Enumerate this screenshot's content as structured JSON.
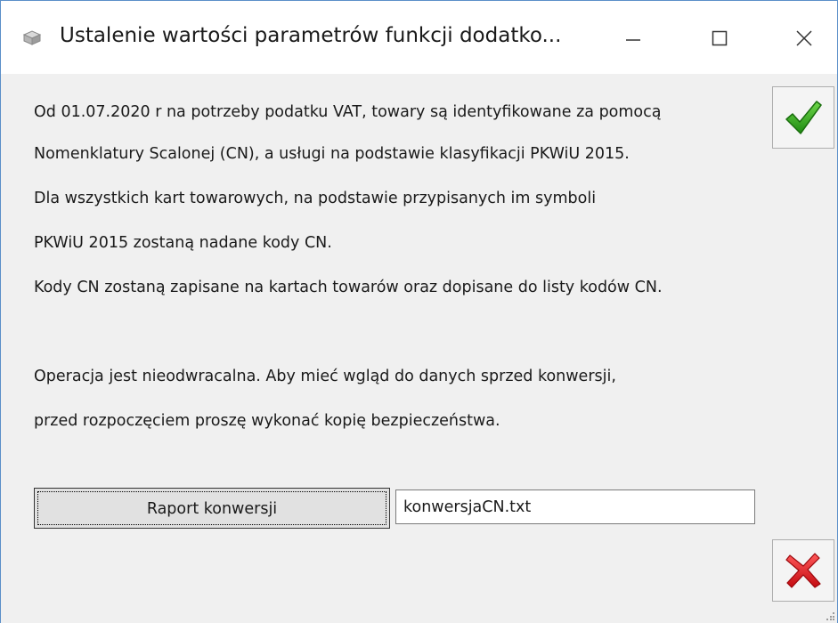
{
  "window": {
    "title": "Ustalenie wartości parametrów funkcji dodatko...",
    "controls": {
      "minimize_icon": "minimize-icon",
      "maximize_icon": "maximize-icon",
      "close_icon": "close-icon"
    }
  },
  "message": {
    "lines": [
      "Od 01.07.2020 r na potrzeby podatku VAT, towary są identyfikowane za pomocą",
      "Nomenklatury Scalonej (CN), a usługi na podstawie klasyfikacji PKWiU 2015.",
      "Dla wszystkich kart towarowych, na podstawie przypisanych im symboli",
      "PKWiU 2015 zostaną nadane kody CN.",
      "Kody CN zostaną zapisane na kartach towarów oraz dopisane do listy kodów CN.",
      "Operacja jest nieodwracalna. Aby mieć wgląd do danych sprzed konwersji,",
      "przed rozpoczęciem proszę wykonać kopię bezpieczeństwa."
    ]
  },
  "report": {
    "button_label": "Raport konwersji",
    "filename": "konwersjaCN.txt"
  },
  "actions": {
    "ok_icon": "green-checkmark-icon",
    "cancel_icon": "red-x-icon"
  },
  "colors": {
    "accent_border": "#5b8fc9",
    "ok_green": "#2e9e1e",
    "cancel_red": "#e2161c"
  }
}
